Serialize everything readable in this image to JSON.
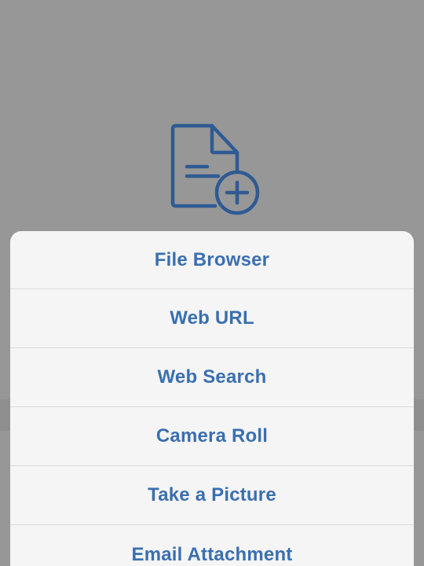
{
  "icon": {
    "name": "document-add-icon",
    "color": "#2f5a93"
  },
  "sheet": {
    "accent_color": "#3a6fb0",
    "items": [
      {
        "label": "File Browser"
      },
      {
        "label": "Web URL"
      },
      {
        "label": "Web Search"
      },
      {
        "label": "Camera Roll"
      },
      {
        "label": "Take a Picture"
      },
      {
        "label": "Email Attachment"
      }
    ]
  }
}
